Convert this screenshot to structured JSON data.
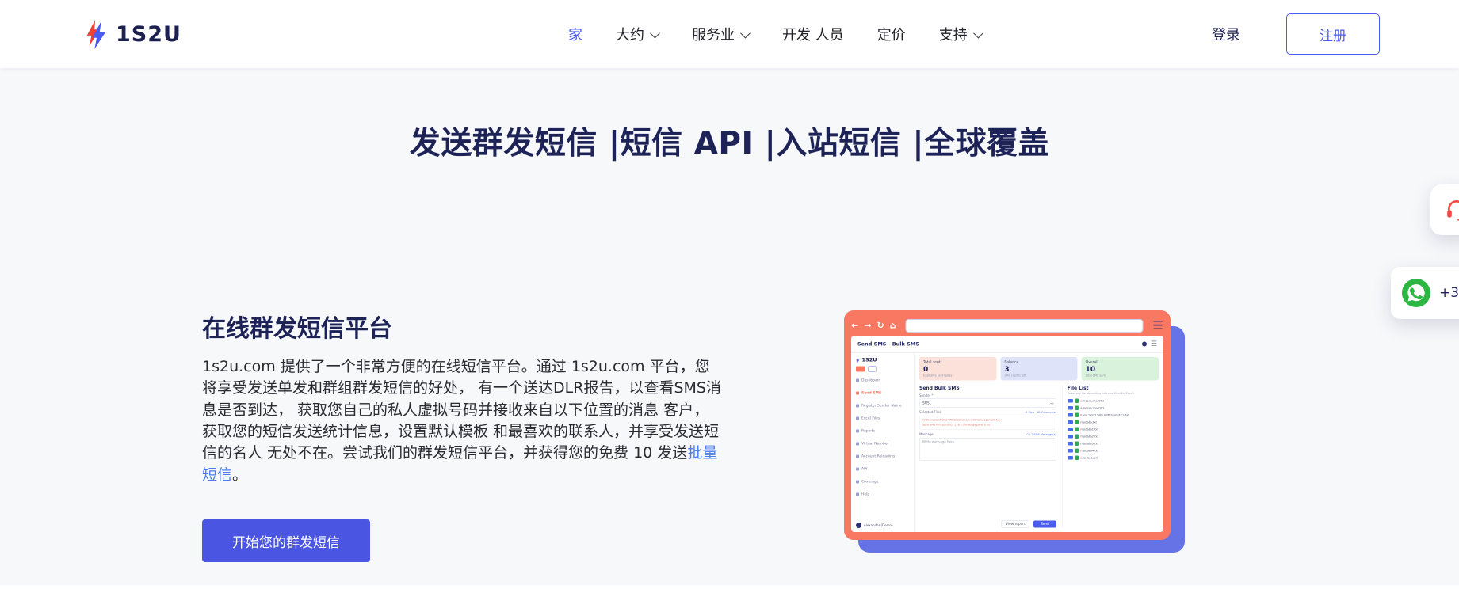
{
  "colors": {
    "accent_blue": "#4a5cf0",
    "button_blue": "#4a55e1",
    "navy": "#1e2357",
    "coral": "#f87862",
    "shadow_purple": "#6673e6",
    "whatsapp_green": "#2cb742",
    "headset_red": "#f2473f",
    "link_blue": "#4a7df0",
    "hero_bg": "#f7f8fa"
  },
  "header": {
    "logo_text": "1S2U",
    "nav": [
      {
        "label": "家"
      },
      {
        "label": "大约"
      },
      {
        "label": "服务业"
      },
      {
        "label": "开发 人员"
      },
      {
        "label": "定价"
      },
      {
        "label": "支持"
      }
    ],
    "login_label": "登录",
    "register_label": "注册"
  },
  "hero": {
    "title": "发送群发短信 |短信 API |入站短信 |全球覆盖"
  },
  "floating": {
    "whatsapp_number": "+3"
  },
  "intro": {
    "heading": "在线群发短信平台",
    "body": "1s2u.com 提供了一个非常方便的在线短信平台。通过 1s2u.com 平台，您将享受发送单发和群组群发短信的好处， 有一个送达DLR报告，以查看SMS消息是否到达， 获取您自己的私人虚拟号码并接收来自以下位置的消息 客户，获取您的短信发送统计信息，设置默认模板 和最喜欢的联系人，并享受发送短信的名人 无处不在。尝试我们的群发短信平台，并获得您的免费 10 发送",
    "link_text": "批量短信",
    "after_link": "。",
    "cta": "开始您的群发短信"
  },
  "dashboard": {
    "window_title": "Send SMS - Bulk SMS",
    "logo_text": "1S2U",
    "menu": [
      {
        "label": "Dashboard"
      },
      {
        "label": "Send SMS"
      },
      {
        "label": "Register Sender Name"
      },
      {
        "label": "Excel Files"
      },
      {
        "label": "Reports"
      },
      {
        "label": "Virtual Number"
      },
      {
        "label": "Account Reloading"
      },
      {
        "label": "API"
      },
      {
        "label": "Coverage"
      },
      {
        "label": "Help"
      }
    ],
    "user": "Alexander (Demo)",
    "stats": [
      {
        "label": "Total sent",
        "value": "0",
        "sub": "total SMS sent today"
      },
      {
        "label": "Balance",
        "value": "3",
        "sub": "SMS credits left"
      },
      {
        "label": "Overall",
        "value": "10",
        "sub": "total SMS sent"
      }
    ],
    "form": {
      "title": "Send Bulk SMS",
      "sender_label": "Sender *",
      "sender_value": "SMS1",
      "selected_files_label": "Selected Files",
      "selected_files_info": "0 files · 100% success",
      "notice_lines": [
        "Ordinary Send SMS Will Statistics.txt (100%Engagement.txt)",
        "Send SMS Will Statistics 1.txt (100%Engagement.txt)"
      ],
      "message_label": "Message",
      "message_counter": "0 / 1 SMS Message(s)",
      "message_placeholder": "Write message here...",
      "view_report_label": "View report",
      "send_label": "Send"
    },
    "file_list": {
      "title": "File List",
      "subtitle": "Select any file for sending bulk sms files (Ex: Excel)",
      "files": [
        {
          "name": "ameera.mar001"
        },
        {
          "name": "ameera.mar002"
        },
        {
          "name": "Easy Send SMS Wifi Statistics.txt"
        },
        {
          "name": "mydata.txt"
        },
        {
          "name": "mydata1.txt"
        },
        {
          "name": "mydata2.txt"
        },
        {
          "name": "mydata3.txt"
        },
        {
          "name": "mydata4.txt"
        },
        {
          "name": "anydata.txt"
        }
      ]
    }
  }
}
